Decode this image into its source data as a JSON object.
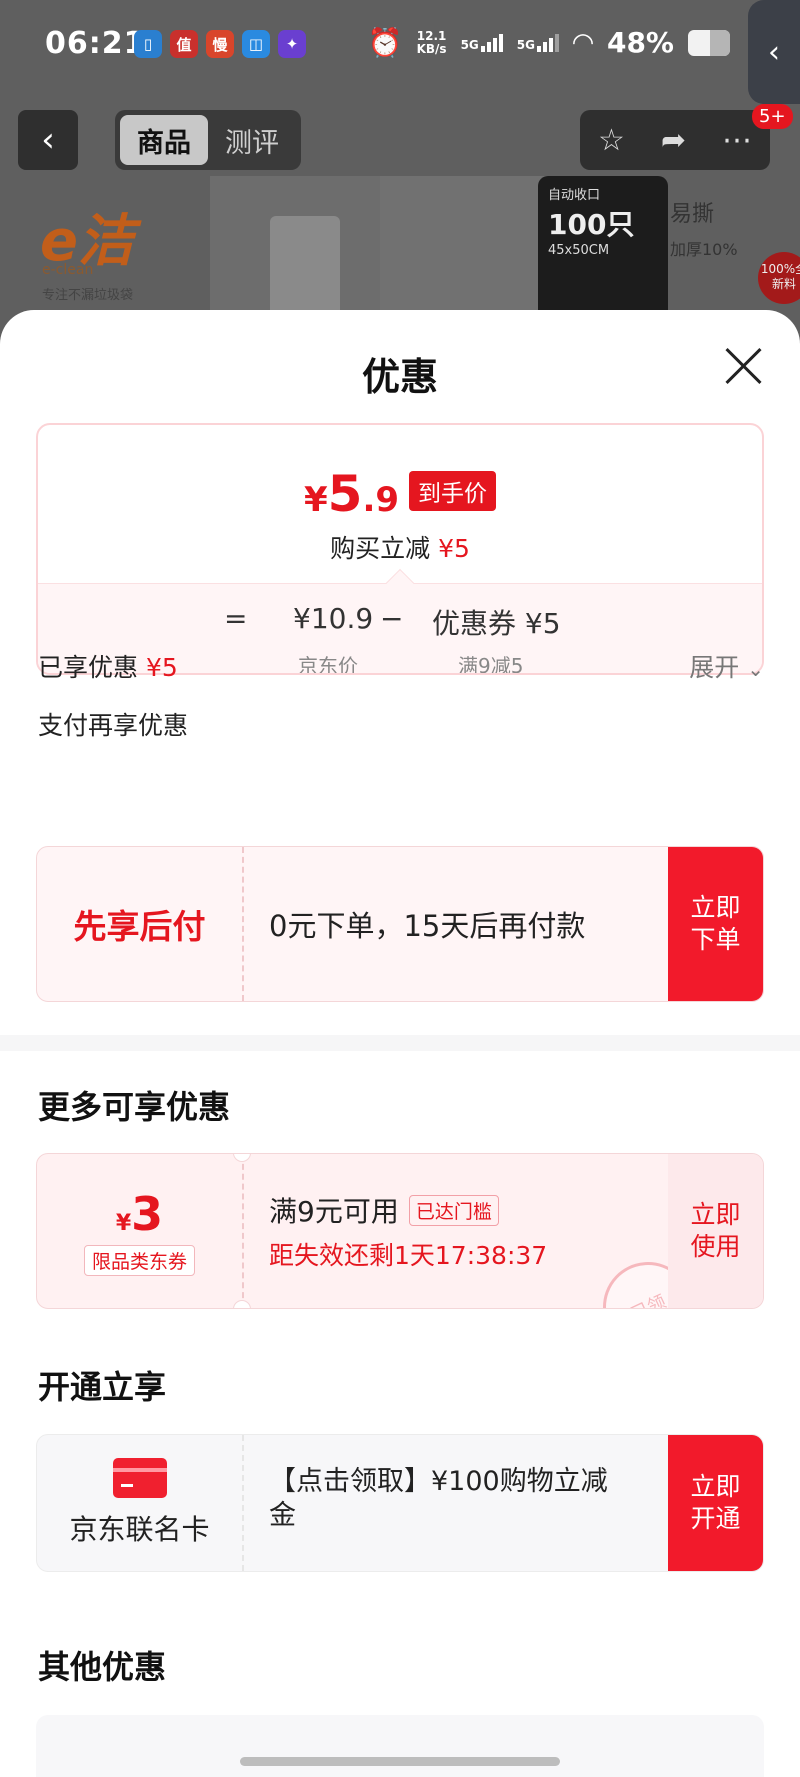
{
  "status_bar": {
    "time": "06:21",
    "net_speed_value": "12.1",
    "net_speed_unit": "KB/s",
    "signal1": "5G",
    "signal2": "5G",
    "battery": "48%"
  },
  "nav": {
    "tabs": [
      "商品",
      "测评"
    ],
    "active_tab": 0,
    "badge": "5+"
  },
  "banner": {
    "brand": "e洁",
    "brand_sub": "e-clean",
    "brand_tagline": "专注不漏垃圾袋",
    "card_title": "自动收口",
    "card_count": "100只",
    "card_size": "45x50CM",
    "right_label": "易撕",
    "right_sub": "加厚10%",
    "right_badge": "100%全新料"
  },
  "sheet": {
    "title": "优惠",
    "price": {
      "currency": "¥",
      "integer": "5",
      "decimal": ".9",
      "tag": "到手价",
      "reduce_label": "购买立减",
      "reduce_value": "¥5",
      "equals": "=",
      "base_price": "¥10.9",
      "minus": "−",
      "coupon_label": "优惠券 ¥5",
      "base_caption": "京东价",
      "coupon_caption": "满9减5"
    },
    "enjoyed_label": "已享优惠",
    "enjoyed_value": "¥5",
    "expand_label": "展开",
    "pay_label": "支付再享优惠",
    "bnpl": {
      "title": "先享后付",
      "desc": "0元下单，15天后再付款",
      "btn_line1": "立即",
      "btn_line2": "下单"
    },
    "more_title": "更多可享优惠",
    "coupon": {
      "currency": "¥",
      "amount": "3",
      "type": "限品类东券",
      "condition": "满9元可用",
      "badge": "已达门槛",
      "expire": "距失效还剩1天17:38:37",
      "stamp": "已领",
      "btn_line1": "立即",
      "btn_line2": "使用"
    },
    "open_title": "开通立享",
    "card_offer": {
      "name": "京东联名卡",
      "desc": "【点击领取】¥100购物立减金",
      "btn_line1": "立即",
      "btn_line2": "开通"
    },
    "other_title": "其他优惠"
  },
  "colors": {
    "accent_red": "#e5161f",
    "button_red": "#f21a2b",
    "pink_bg": "#fff5f6"
  }
}
